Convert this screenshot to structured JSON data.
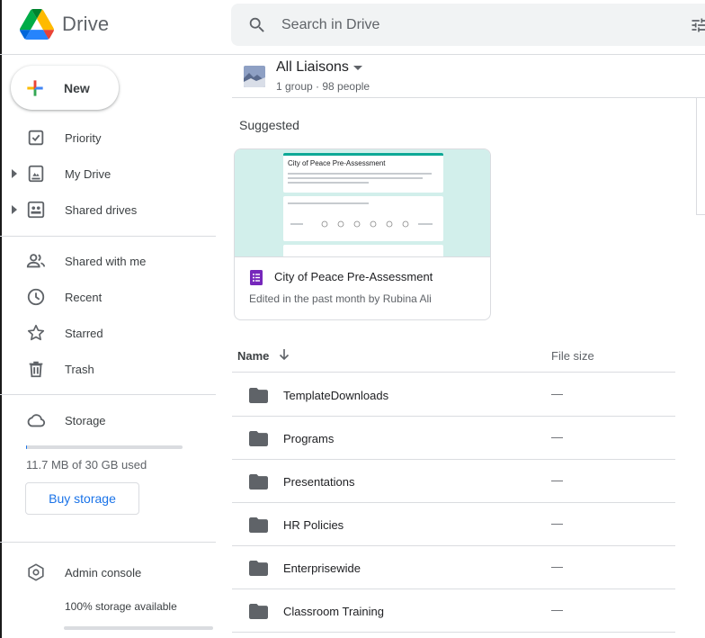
{
  "app": {
    "name": "Drive"
  },
  "search": {
    "placeholder": "Search in Drive"
  },
  "sidebar": {
    "new_label": "New",
    "items": [
      {
        "label": "Priority",
        "icon": "priority-icon"
      },
      {
        "label": "My Drive",
        "icon": "my-drive-icon"
      },
      {
        "label": "Shared drives",
        "icon": "shared-drives-icon"
      },
      {
        "label": "Shared with me",
        "icon": "people-icon"
      },
      {
        "label": "Recent",
        "icon": "clock-icon"
      },
      {
        "label": "Starred",
        "icon": "star-icon"
      },
      {
        "label": "Trash",
        "icon": "trash-icon"
      },
      {
        "label": "Storage",
        "icon": "cloud-icon"
      }
    ],
    "storage": {
      "used_text": "11.7 MB of 30 GB used",
      "used_fraction": 0.0004,
      "buy_label": "Buy storage"
    },
    "admin": {
      "label": "Admin console",
      "note": "100% storage available"
    }
  },
  "main": {
    "group": {
      "title": "All Liaisons",
      "subtitle": "1 group · 98 people"
    },
    "suggested_label": "Suggested",
    "suggested_card": {
      "thumb_title": "City of Peace Pre-Assessment",
      "title": "City of Peace Pre-Assessment",
      "subtitle": "Edited in the past month by Rubina Ali"
    },
    "columns": {
      "name": "Name",
      "size": "File size"
    },
    "files": [
      {
        "name": "TemplateDownloads",
        "size": "—"
      },
      {
        "name": "Programs",
        "size": "—"
      },
      {
        "name": "Presentations",
        "size": "—"
      },
      {
        "name": "HR Policies",
        "size": "—"
      },
      {
        "name": "Enterprisewide",
        "size": "—"
      },
      {
        "name": "Classroom Training",
        "size": "—"
      }
    ]
  },
  "colors": {
    "accent": "#1a73e8",
    "forms_purple": "#7627bb",
    "folder": "#5f6368"
  }
}
